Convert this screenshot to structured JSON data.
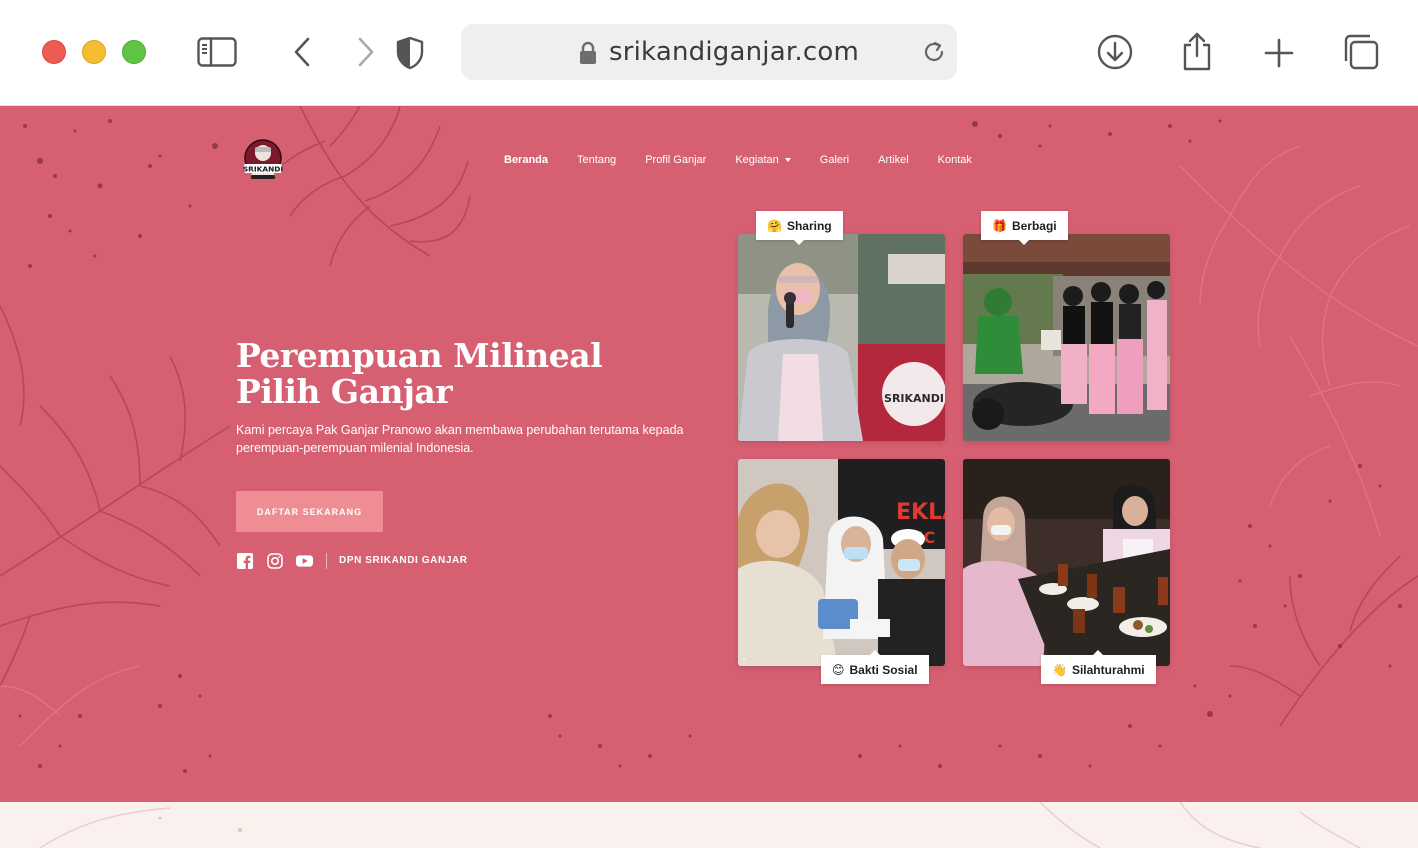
{
  "browser": {
    "url": "srikandiganjar.com",
    "icons": [
      "sidebar-icon",
      "back-icon",
      "forward-icon",
      "shield-icon",
      "lock-icon",
      "reload-icon",
      "download-icon",
      "share-icon",
      "new-tab-icon",
      "tabs-icon"
    ]
  },
  "nav": {
    "logo_alt": "SRIKANDI",
    "items": [
      {
        "label": "Beranda",
        "active": true
      },
      {
        "label": "Tentang"
      },
      {
        "label": "Profil Ganjar"
      },
      {
        "label": "Kegiatan",
        "dropdown": true
      },
      {
        "label": "Galeri"
      },
      {
        "label": "Artikel"
      },
      {
        "label": "Kontak"
      }
    ]
  },
  "hero": {
    "title": "Perempuan Milineal Pilih Ganjar",
    "description": "Kami percaya Pak Ganjar Pranowo akan membawa perubahan terutama kepada perempuan-perempuan milenial Indonesia.",
    "cta_label": "DAFTAR SEKARANG",
    "social_label": "DPN SRIKANDI GANJAR",
    "social_icons": [
      "facebook-icon",
      "instagram-icon",
      "youtube-icon"
    ]
  },
  "gallery": [
    {
      "tag": "Sharing",
      "emoji": "🤗"
    },
    {
      "tag": "Berbagi",
      "emoji": "🎁"
    },
    {
      "tag": "Bakti Sosial",
      "emoji": "😊"
    },
    {
      "tag": "Silahturahmi",
      "emoji": "👋"
    }
  ],
  "colors": {
    "hero_bg": "#d65f72",
    "cta_bg": "#ee8d93",
    "bottom_band": "#faf1ef"
  }
}
